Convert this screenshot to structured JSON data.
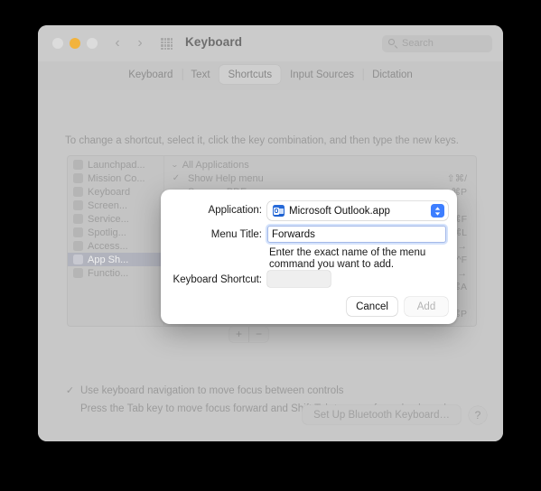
{
  "window": {
    "title": "Keyboard",
    "traffic_lights": [
      "close",
      "minimize",
      "maximize"
    ],
    "nav_back": "‹",
    "nav_forward": "›",
    "grid_icon": "grid-icon",
    "search": {
      "placeholder": "Search",
      "value": ""
    }
  },
  "tabs": [
    {
      "label": "Keyboard",
      "selected": false
    },
    {
      "label": "Text",
      "selected": false
    },
    {
      "label": "Shortcuts",
      "selected": true
    },
    {
      "label": "Input Sources",
      "selected": false
    },
    {
      "label": "Dictation",
      "selected": false
    }
  ],
  "hint": "To change a shortcut, select it, click the key combination, and then type the new keys.",
  "sidebar": {
    "items": [
      {
        "label": "Launchpad...",
        "icon": "launchpad-icon",
        "selected": false
      },
      {
        "label": "Mission Co...",
        "icon": "mission-control-icon",
        "selected": false
      },
      {
        "label": "Keyboard",
        "icon": "keyboard-icon",
        "selected": false
      },
      {
        "label": "Screen...",
        "icon": "screenshot-icon",
        "selected": false
      },
      {
        "label": "Service...",
        "icon": "services-icon",
        "selected": false
      },
      {
        "label": "Spotlig...",
        "icon": "spotlight-icon",
        "selected": false
      },
      {
        "label": "Access...",
        "icon": "accessibility-icon",
        "selected": false
      },
      {
        "label": "App Sh...",
        "icon": "app-shortcuts-icon",
        "selected": true
      },
      {
        "label": "Functio...",
        "icon": "function-keys-icon",
        "selected": false
      }
    ]
  },
  "shortcut_list": {
    "group_label": "All Applications",
    "disclosure": "⌄",
    "rows": [
      {
        "checked": true,
        "name": "Show Help menu",
        "key": "⇧⌘/"
      },
      {
        "checked": false,
        "name": "Save as PDF",
        "key": "⌘P"
      },
      {
        "checked": false,
        "name": "",
        "key": ""
      },
      {
        "checked": false,
        "name": "",
        "key": "⇧⌘F"
      },
      {
        "checked": false,
        "name": "",
        "key": "⌘L"
      },
      {
        "checked": false,
        "name": "",
        "key": "⇧⌘→"
      },
      {
        "checked": false,
        "name": "",
        "key": "^F"
      },
      {
        "checked": false,
        "name": "",
        "key": "⌘→"
      },
      {
        "checked": false,
        "name": "",
        "key": "⇧⌘A"
      },
      {
        "checked": false,
        "name": "",
        "key": ""
      },
      {
        "checked": false,
        "name": "",
        "key": "^⌘P"
      }
    ],
    "check_glyph": "✓"
  },
  "list_controls": {
    "add": "+",
    "remove": "−"
  },
  "keyboard_navigation": {
    "check_glyph": "✓",
    "label": "Use keyboard navigation to move focus between controls",
    "sublabel": "Press the Tab key to move focus forward and Shift Tab to move focus backward."
  },
  "footer": {
    "bluetooth_button": "Set Up Bluetooth Keyboard…",
    "help_button": "?"
  },
  "dialog": {
    "application": {
      "label": "Application:",
      "value": "Microsoft Outlook.app",
      "icon": "outlook-icon",
      "chevron_up": "▲",
      "chevron_down": "▼"
    },
    "menu_title": {
      "label": "Menu Title:",
      "value": "Forwards",
      "placeholder": "",
      "help": "Enter the exact name of the menu command you want to add."
    },
    "keyboard_shortcut": {
      "label": "Keyboard Shortcut:",
      "value": ""
    },
    "cancel_label": "Cancel",
    "add_label": "Add"
  },
  "colors": {
    "accent_blue": "#3d7eff",
    "focus_ring": "#a4b9e8",
    "selection": "#b1b3bd",
    "window_bg": "#c8c8c8",
    "dialog_bg": "#ffffff",
    "minimize_yellow": "#f2b33d"
  }
}
